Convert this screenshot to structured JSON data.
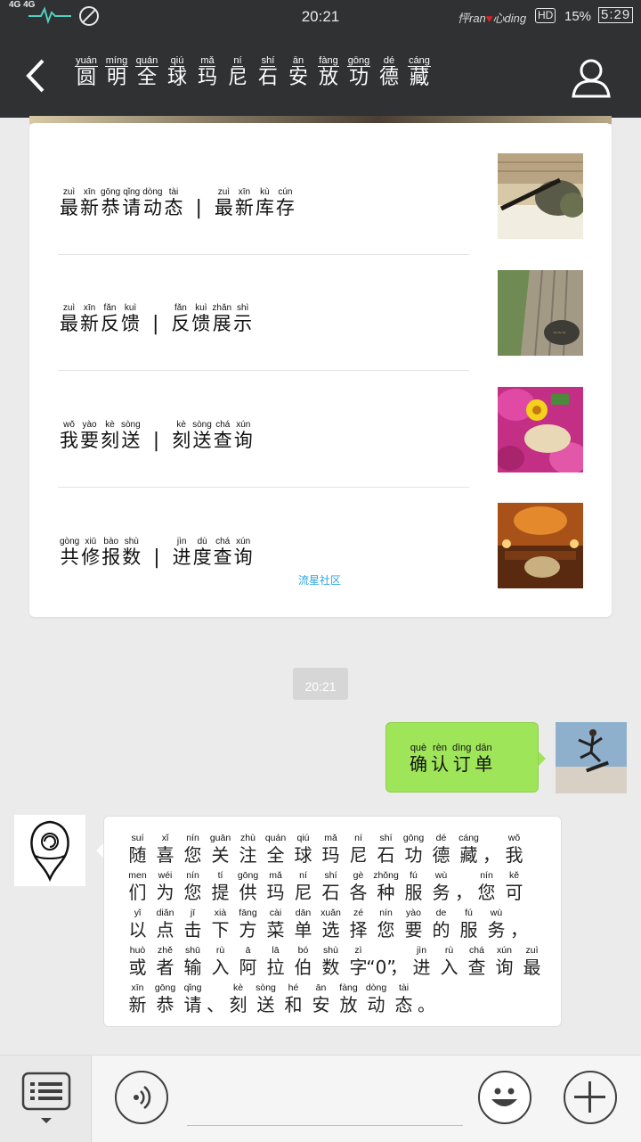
{
  "status_bar": {
    "network": "4G 4G",
    "time": "20:21",
    "signature": "怦ran",
    "signature_end": "心ding",
    "hd": "HD",
    "battery": "15%",
    "clock_text": "5:29"
  },
  "header": {
    "back_icon": "chevron-left-icon",
    "profile_icon": "person-icon",
    "title": [
      {
        "py": "yuán",
        "hz": "圆"
      },
      {
        "py": "míng",
        "hz": "明"
      },
      {
        "py": "quán",
        "hz": "全"
      },
      {
        "py": "qiú",
        "hz": "球"
      },
      {
        "py": "mǎ",
        "hz": "玛"
      },
      {
        "py": "ní",
        "hz": "尼"
      },
      {
        "py": "shí",
        "hz": "石"
      },
      {
        "py": "ān",
        "hz": "安"
      },
      {
        "py": "fàng",
        "hz": "放"
      },
      {
        "py": "gōng",
        "hz": "功"
      },
      {
        "py": "dé",
        "hz": "德"
      },
      {
        "py": "cáng",
        "hz": "藏"
      }
    ]
  },
  "menu": {
    "rows": [
      {
        "left": [
          {
            "py": "zuì",
            "hz": "最"
          },
          {
            "py": "xīn",
            "hz": "新"
          },
          {
            "py": "gōng",
            "hz": "恭"
          },
          {
            "py": "qǐng",
            "hz": "请"
          },
          {
            "py": "dòng",
            "hz": "动"
          },
          {
            "py": "tài",
            "hz": "态"
          }
        ],
        "separator": "|",
        "right": [
          {
            "py": "zuì",
            "hz": "最"
          },
          {
            "py": "xīn",
            "hz": "新"
          },
          {
            "py": "kù",
            "hz": "库"
          },
          {
            "py": "cún",
            "hz": "存"
          }
        ]
      },
      {
        "left": [
          {
            "py": "zuì",
            "hz": "最"
          },
          {
            "py": "xīn",
            "hz": "新"
          },
          {
            "py": "fǎn",
            "hz": "反"
          },
          {
            "py": "kuì",
            "hz": "馈"
          }
        ],
        "separator": "|",
        "right": [
          {
            "py": "fǎn",
            "hz": "反"
          },
          {
            "py": "kuì",
            "hz": "馈"
          },
          {
            "py": "zhǎn",
            "hz": "展"
          },
          {
            "py": "shì",
            "hz": "示"
          }
        ]
      },
      {
        "left": [
          {
            "py": "wǒ",
            "hz": "我"
          },
          {
            "py": "yào",
            "hz": "要"
          },
          {
            "py": "kè",
            "hz": "刻"
          },
          {
            "py": "sòng",
            "hz": "送"
          }
        ],
        "separator": "|",
        "right": [
          {
            "py": "kè",
            "hz": "刻"
          },
          {
            "py": "sòng",
            "hz": "送"
          },
          {
            "py": "chá",
            "hz": "查"
          },
          {
            "py": "xún",
            "hz": "询"
          }
        ]
      },
      {
        "left": [
          {
            "py": "gòng",
            "hz": "共"
          },
          {
            "py": "xiū",
            "hz": "修"
          },
          {
            "py": "bào",
            "hz": "报"
          },
          {
            "py": "shù",
            "hz": "数"
          }
        ],
        "separator": "|",
        "right": [
          {
            "py": "jìn",
            "hz": "进"
          },
          {
            "py": "dù",
            "hz": "度"
          },
          {
            "py": "chá",
            "hz": "查"
          },
          {
            "py": "xún",
            "hz": "询"
          }
        ],
        "watermark": "流星社区"
      }
    ]
  },
  "chat": {
    "timestamp": "20:21",
    "sent": [
      {
        "py": "què",
        "hz": "确"
      },
      {
        "py": "rèn",
        "hz": "认"
      },
      {
        "py": "dìng",
        "hz": "订"
      },
      {
        "py": "dān",
        "hz": "单"
      }
    ],
    "received": [
      {
        "py": "suí",
        "hz": "随"
      },
      {
        "py": "xǐ",
        "hz": "喜"
      },
      {
        "py": "nín",
        "hz": "您"
      },
      {
        "py": "guān",
        "hz": "关"
      },
      {
        "py": "zhù",
        "hz": "注"
      },
      {
        "py": "quán",
        "hz": "全"
      },
      {
        "py": "qiú",
        "hz": "球"
      },
      {
        "py": "mǎ",
        "hz": "玛"
      },
      {
        "py": "ní",
        "hz": "尼"
      },
      {
        "py": "shí",
        "hz": "石"
      },
      {
        "py": "gōng",
        "hz": "功"
      },
      {
        "py": "dé",
        "hz": "德"
      },
      {
        "py": "cáng",
        "hz": "藏"
      },
      {
        "py": "",
        "hz": "，",
        "p": true
      },
      {
        "py": "wǒ",
        "hz": "我"
      },
      {
        "py": "men",
        "hz": "们"
      },
      {
        "py": "wéi",
        "hz": "为"
      },
      {
        "py": "nín",
        "hz": "您"
      },
      {
        "py": "tí",
        "hz": "提"
      },
      {
        "py": "gōng",
        "hz": "供"
      },
      {
        "py": "mǎ",
        "hz": "玛"
      },
      {
        "py": "ní",
        "hz": "尼"
      },
      {
        "py": "shí",
        "hz": "石"
      },
      {
        "py": "gè",
        "hz": "各"
      },
      {
        "py": "zhǒng",
        "hz": "种"
      },
      {
        "py": "fú",
        "hz": "服"
      },
      {
        "py": "wù",
        "hz": "务"
      },
      {
        "py": "",
        "hz": "，",
        "p": true
      },
      {
        "py": "nín",
        "hz": "您"
      },
      {
        "py": "kě",
        "hz": "可"
      },
      {
        "py": "yǐ",
        "hz": "以"
      },
      {
        "py": "diǎn",
        "hz": "点"
      },
      {
        "py": "jī",
        "hz": "击"
      },
      {
        "py": "xià",
        "hz": "下"
      },
      {
        "py": "fāng",
        "hz": "方"
      },
      {
        "py": "cài",
        "hz": "菜"
      },
      {
        "py": "dān",
        "hz": "单"
      },
      {
        "py": "xuǎn",
        "hz": "选"
      },
      {
        "py": "zé",
        "hz": "择"
      },
      {
        "py": "nín",
        "hz": "您"
      },
      {
        "py": "yào",
        "hz": "要"
      },
      {
        "py": "de",
        "hz": "的"
      },
      {
        "py": "fú",
        "hz": "服"
      },
      {
        "py": "wù",
        "hz": "务"
      },
      {
        "py": "",
        "hz": "，",
        "p": true
      },
      {
        "py": "huò",
        "hz": "或"
      },
      {
        "py": "zhě",
        "hz": "者"
      },
      {
        "py": "shū",
        "hz": "输"
      },
      {
        "py": "rù",
        "hz": "入"
      },
      {
        "py": "ā",
        "hz": "阿"
      },
      {
        "py": "lā",
        "hz": "拉"
      },
      {
        "py": "bó",
        "hz": "伯"
      },
      {
        "py": "shù",
        "hz": "数"
      },
      {
        "py": "zì",
        "hz": "字"
      },
      {
        "py": "",
        "hz": "“0”",
        "p": true
      },
      {
        "py": "",
        "hz": "，",
        "p": true
      },
      {
        "py": "jìn",
        "hz": "进"
      },
      {
        "py": "rù",
        "hz": "入"
      },
      {
        "py": "chá",
        "hz": "查"
      },
      {
        "py": "xún",
        "hz": "询"
      },
      {
        "py": "zuì",
        "hz": "最"
      },
      {
        "py": "xīn",
        "hz": "新"
      },
      {
        "py": "gōng",
        "hz": "恭"
      },
      {
        "py": "qǐng",
        "hz": "请"
      },
      {
        "py": "",
        "hz": "、",
        "p": true
      },
      {
        "py": "kè",
        "hz": "刻"
      },
      {
        "py": "sòng",
        "hz": "送"
      },
      {
        "py": "hé",
        "hz": "和"
      },
      {
        "py": "ān",
        "hz": "安"
      },
      {
        "py": "fàng",
        "hz": "放"
      },
      {
        "py": "dòng",
        "hz": "动"
      },
      {
        "py": "tài",
        "hz": "态"
      },
      {
        "py": "",
        "hz": "。",
        "p": true
      }
    ]
  },
  "bottom_bar": {
    "menu_icon": "list-menu-icon",
    "voice_icon": "voice-icon",
    "emoji_icon": "smiley-icon",
    "plus_icon": "plus-icon"
  }
}
